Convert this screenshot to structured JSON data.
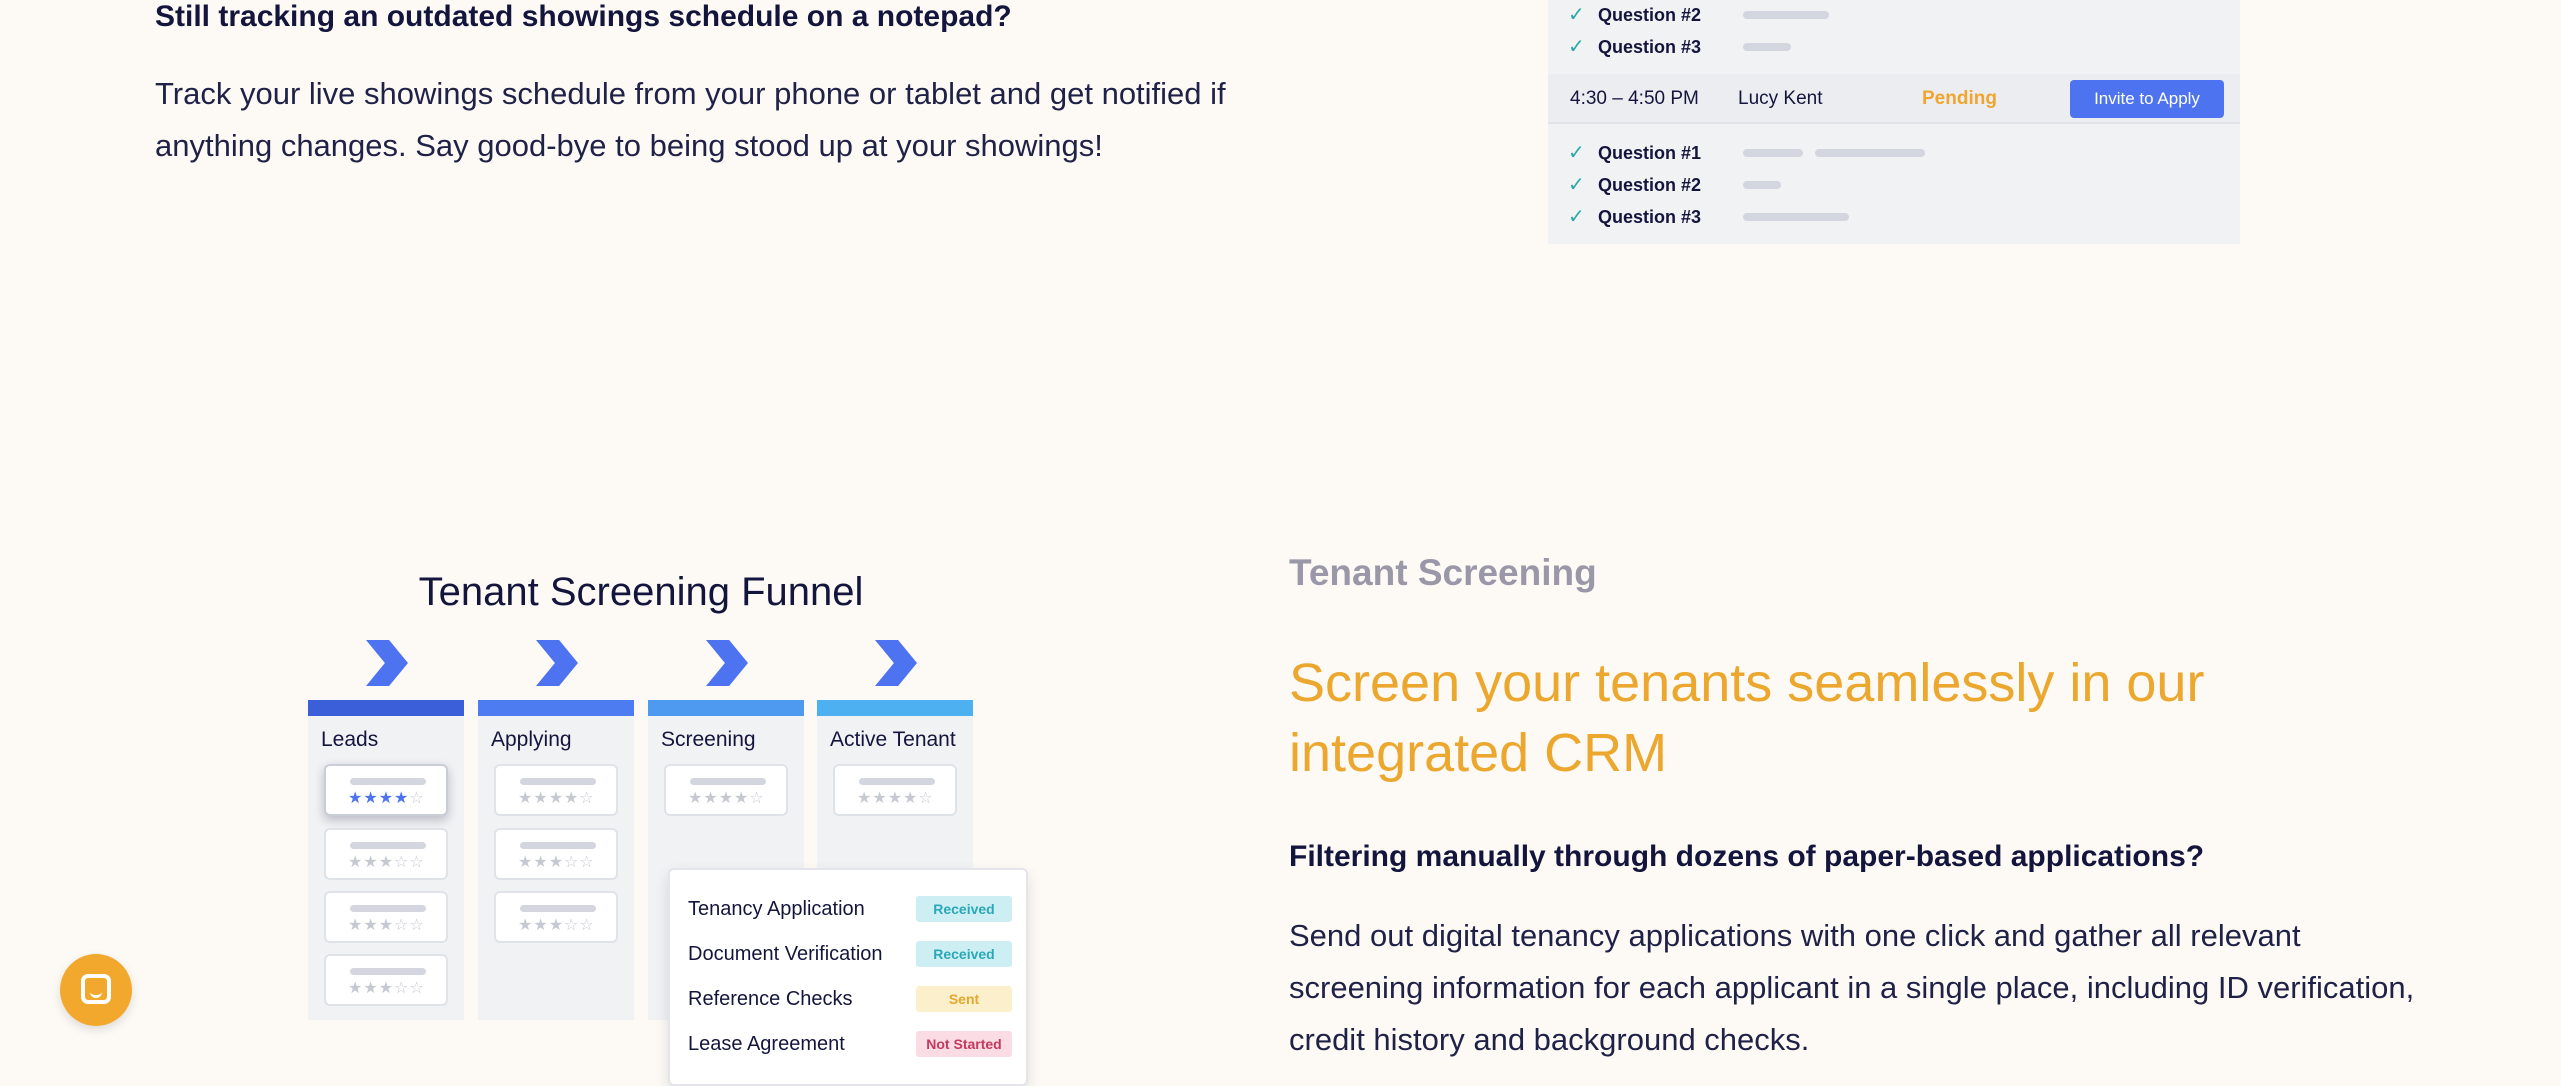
{
  "showings": {
    "heading": "Still tracking an outdated showings schedule on a notepad?",
    "body": "Track your live showings schedule from your phone or tablet and get notified if anything changes. Say good-bye to being stood up at your showings!",
    "schedule": {
      "upper_questions": [
        "Question #2",
        "Question #3"
      ],
      "slot": {
        "time": "4:30 – 4:50 PM",
        "name": "Lucy Kent",
        "status": "Pending",
        "button": "Invite to Apply"
      },
      "lower_questions": [
        "Question #1",
        "Question #2",
        "Question #3"
      ]
    }
  },
  "funnel": {
    "title": "Tenant Screening Funnel",
    "columns": [
      {
        "label": "Leads",
        "color": "#3a5fd9"
      },
      {
        "label": "Applying",
        "color": "#4d7cf0"
      },
      {
        "label": "Screening",
        "color": "#4d9af0"
      },
      {
        "label": "Active Tenant",
        "color": "#4db0f0"
      }
    ],
    "checklist": [
      {
        "label": "Tenancy Application",
        "status": "Received"
      },
      {
        "label": "Document Verification",
        "status": "Received"
      },
      {
        "label": "Reference Checks",
        "status": "Sent"
      },
      {
        "label": "Lease Agreement",
        "status": "Not Started"
      }
    ]
  },
  "screening": {
    "label": "Tenant Screening",
    "title": "Screen your tenants seamlessly in our integrated CRM",
    "subheading": "Filtering manually through dozens of paper-based applications?",
    "body": "Send out digital tenancy applications with one click and gather all relevant screening information for each applicant in a single place, including ID verification, credit history and background checks."
  },
  "colors": {
    "accent": "#eba72e",
    "primary_button": "#4d73f0",
    "navy": "#14153d",
    "background": "#fdfaf5"
  },
  "icons": {
    "check": "check-icon",
    "chat": "chat-bubble-icon",
    "chevron": "chevron-right-icon",
    "star": "star-icon"
  }
}
